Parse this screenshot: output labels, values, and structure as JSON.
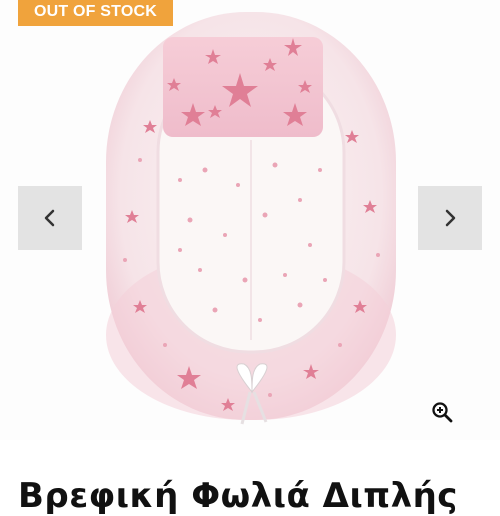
{
  "badge": {
    "label": "OUT OF STOCK",
    "color": "#f0a33c"
  },
  "gallery": {
    "prev_icon": "chevron-left-icon",
    "next_icon": "chevron-right-icon",
    "zoom_icon": "zoom-in-icon"
  },
  "product": {
    "title": "Βρεφική Φωλιά Διπλής"
  },
  "colors": {
    "pink": "#f4c6d2",
    "star": "#e07f96",
    "cream": "#fbf7f6"
  }
}
